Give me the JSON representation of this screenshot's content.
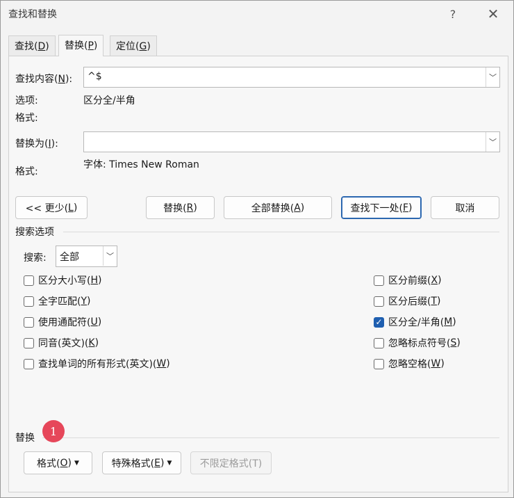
{
  "title": "查找和替换",
  "titlebar": {
    "help": "?",
    "close": "✕"
  },
  "tabs": {
    "find": {
      "text": "查找(",
      "key": "D",
      "end": ")"
    },
    "replace": {
      "text": "替换(",
      "key": "P",
      "end": ")"
    },
    "goto": {
      "text": "定位(",
      "key": "G",
      "end": ")"
    }
  },
  "find": {
    "label": "查找内容(",
    "key": "N",
    "end": "):",
    "value": "^$"
  },
  "options": {
    "label": "选项:",
    "value": "区分全/半角"
  },
  "format1": {
    "label": "格式:"
  },
  "replace_with": {
    "label": "替换为(",
    "key": "I",
    "end": "):",
    "value": ""
  },
  "format2": {
    "label": "格式:",
    "value": "字体: Times New Roman"
  },
  "buttons": {
    "less": {
      "text": "<< 更少(",
      "key": "L",
      "end": ")"
    },
    "replace": {
      "text": "替换(",
      "key": "R",
      "end": ")"
    },
    "replace_all": {
      "text": "全部替换(",
      "key": "A",
      "end": ")"
    },
    "find_next": {
      "text": "查找下一处(",
      "key": "F",
      "end": ")"
    },
    "cancel": {
      "text": "取消"
    }
  },
  "search_options": {
    "title": "搜索选项",
    "search_label": "搜索:",
    "search_value": "全部",
    "left": [
      {
        "text": "区分大小写(",
        "key": "H",
        "end": ")",
        "checked": false
      },
      {
        "text": "全字匹配(",
        "key": "Y",
        "end": ")",
        "checked": false
      },
      {
        "text": "使用通配符(",
        "key": "U",
        "end": ")",
        "checked": false
      },
      {
        "text": "同音(英文)(",
        "key": "K",
        "end": ")",
        "checked": false
      },
      {
        "text": "查找单词的所有形式(英文)(",
        "key": "W",
        "end": ")",
        "checked": false
      }
    ],
    "right": [
      {
        "text": "区分前缀(",
        "key": "X",
        "end": ")",
        "checked": false
      },
      {
        "text": "区分后缀(",
        "key": "T",
        "end": ")",
        "checked": false
      },
      {
        "text": "区分全/半角(",
        "key": "M",
        "end": ")",
        "checked": true
      },
      {
        "text": "忽略标点符号(",
        "key": "S",
        "end": ")",
        "checked": false
      },
      {
        "text": "忽略空格(",
        "key": "W",
        "end": ")",
        "checked": false
      }
    ]
  },
  "replace_section": {
    "title": "替换",
    "badge": "1",
    "format_btn": {
      "text": "格式(",
      "key": "O",
      "end": ")"
    },
    "special_btn": {
      "text": "特殊格式(",
      "key": "E",
      "end": ")"
    },
    "no_format_btn": {
      "text": "不限定格式(T)"
    }
  }
}
